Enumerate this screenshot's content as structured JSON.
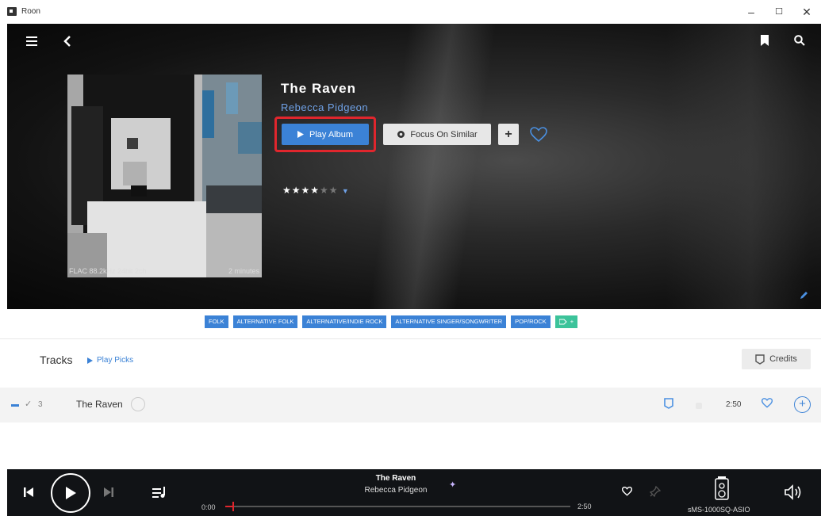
{
  "window": {
    "title": "Roon"
  },
  "album": {
    "title": "The Raven",
    "artist": "Rebecca Pidgeon",
    "format": "FLAC 88.2kHz 24bit 2ch",
    "duration": "2 minutes",
    "rating": 3.5,
    "meta": [
      {
        "label": "",
        "value": ""
      },
      {
        "label": "",
        "value": ""
      },
      {
        "label": "",
        "value": ""
      },
      {
        "label": "",
        "value": ""
      }
    ]
  },
  "actions": {
    "play_album": "Play Album",
    "focus_on_similar": "Focus On Similar",
    "add": "+"
  },
  "genres": [
    "FOLK",
    "ALTERNATIVE FOLK",
    "ALTERNATIVE/INDIE ROCK",
    "ALTERNATIVE SINGER/SONGWRITER",
    "POP/ROCK"
  ],
  "tracks_section": {
    "heading": "Tracks",
    "play_picks": "Play Picks",
    "credits": "Credits"
  },
  "tracks": [
    {
      "number": "3",
      "title": "The Raven",
      "length": "2:50"
    }
  ],
  "player": {
    "now_title": "The Raven",
    "now_artist": "Rebecca Pidgeon",
    "elapsed": "0:00",
    "total": "2:50",
    "progress": 0.02,
    "zone": "sMS-1000SQ-ASIO"
  },
  "colors": {
    "accent": "#3b82d6",
    "highlight": "#e0262d",
    "tag_add": "#3cc39a"
  }
}
